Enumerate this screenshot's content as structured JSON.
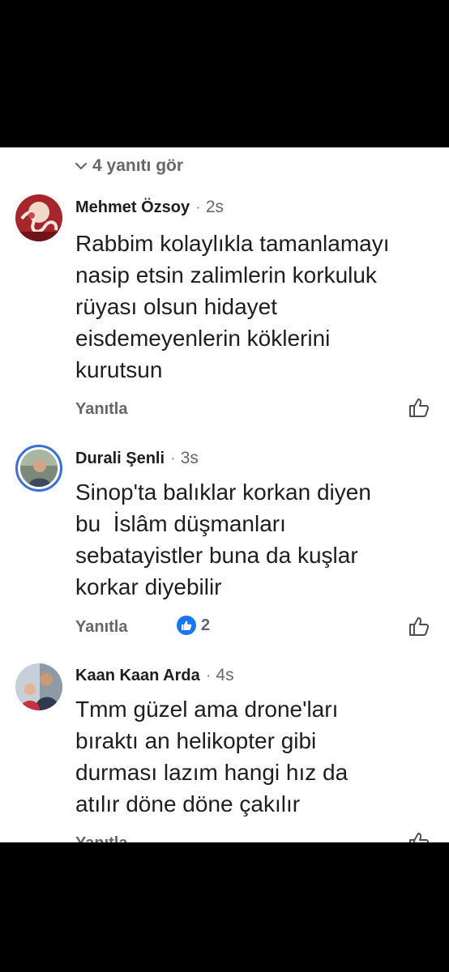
{
  "thread": {
    "view_replies": "4 yanıtı gör"
  },
  "comments": [
    {
      "author": "Mehmet Özsoy",
      "time": "2s",
      "text": "Rabbim kolaylıkla tamanlamayı\nnasip etsin zalimlerin korkuluk\nrüyası olsun hidayet\neisdemeyenlerin köklerini\nkurutsun",
      "reply_label": "Yanıtla",
      "like_icon": "thumbs-up-icon"
    },
    {
      "author": "Durali Şenli",
      "time": "3s",
      "text": "Sinop'ta balıklar korkan diyen\nbu  İslâm düşmanları\nsebatayistler buna da kuşlar\nkorkar diyebilir",
      "reply_label": "Yanıtla",
      "reaction_icon": "like-reaction-icon",
      "reaction_count": "2",
      "like_icon": "thumbs-up-icon"
    },
    {
      "author": "Kaan Kaan Arda",
      "time": "4s",
      "text": "Tmm güzel ama drone'ları\nbıraktı an helikopter gibi\ndurması lazım hangi hız da\natılır döne döne çakılır",
      "reply_label": "Yanıtla",
      "like_icon": "thumbs-up-icon"
    }
  ],
  "colors": {
    "background": "#000000",
    "panel": "#ffffff",
    "text": "#1c1e21",
    "secondary_text": "#65676b",
    "accent": "#1877f2"
  }
}
